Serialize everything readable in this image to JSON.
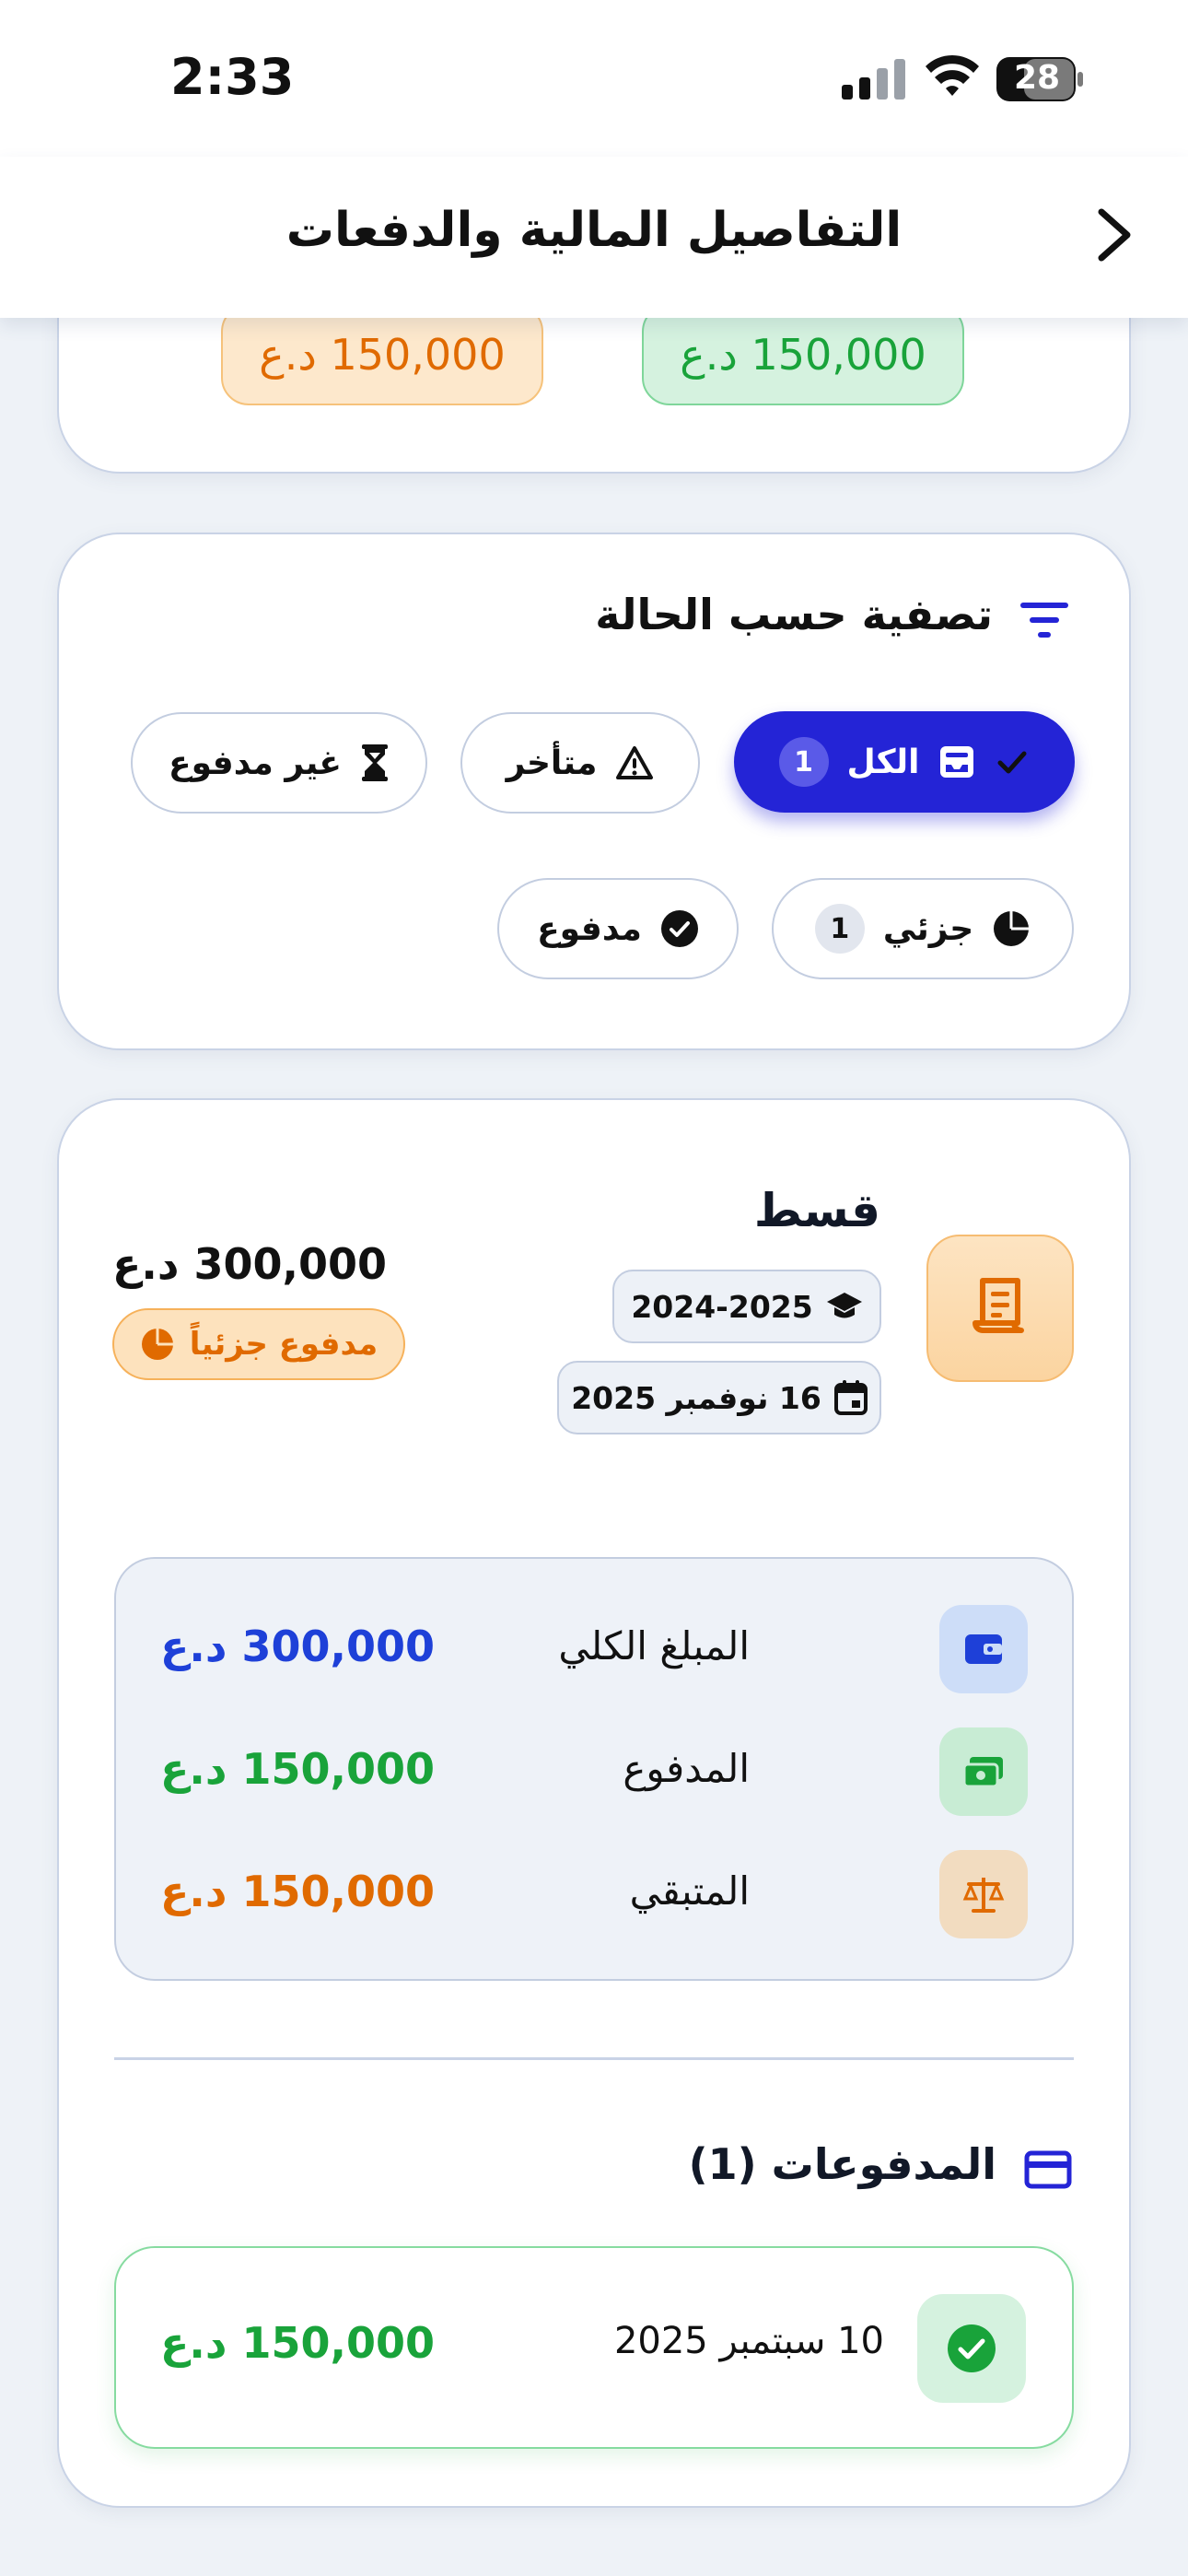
{
  "status_bar": {
    "time": "2:33",
    "battery_level": "28"
  },
  "nav": {
    "title": "التفاصيل المالية والدفعات",
    "back_icon": "chevron-right-icon"
  },
  "summary_pills": {
    "remaining": "150,000 د.ع",
    "paid": "150,000 د.ع"
  },
  "filter": {
    "title": "تصفية حسب الحالة",
    "chips": {
      "all": {
        "label": "الكل",
        "count": "1",
        "icon": "inbox-icon",
        "selected": true
      },
      "late": {
        "label": "متأخر",
        "icon": "warning-icon"
      },
      "unpaid": {
        "label": "غير مدفوع",
        "icon": "hourglass-icon"
      },
      "partial": {
        "label": "جزئي",
        "count": "1",
        "icon": "pie-chart-icon"
      },
      "paid": {
        "label": "مدفوع",
        "icon": "check-circle-icon"
      }
    }
  },
  "installment": {
    "title": "قسط",
    "academic_year": "2024-2025",
    "due_date": "16 نوفمبر 2025",
    "total": "300,000 د.ع",
    "status": "مدفوع جزئياً",
    "summary": {
      "total_label": "المبلغ الكلي",
      "total_value": "300,000 د.ع",
      "paid_label": "المدفوع",
      "paid_value": "150,000 د.ع",
      "remaining_label": "المتبقي",
      "remaining_value": "150,000 د.ع"
    },
    "payments_title": "المدفوعات (1)",
    "payments": [
      {
        "date": "10 سبتمبر 2025",
        "amount": "150,000 د.ع"
      }
    ]
  },
  "colors": {
    "accent": "#2424d6",
    "green": "#19a33a",
    "orange": "#e06a00",
    "blue_value": "#1e40d8"
  }
}
